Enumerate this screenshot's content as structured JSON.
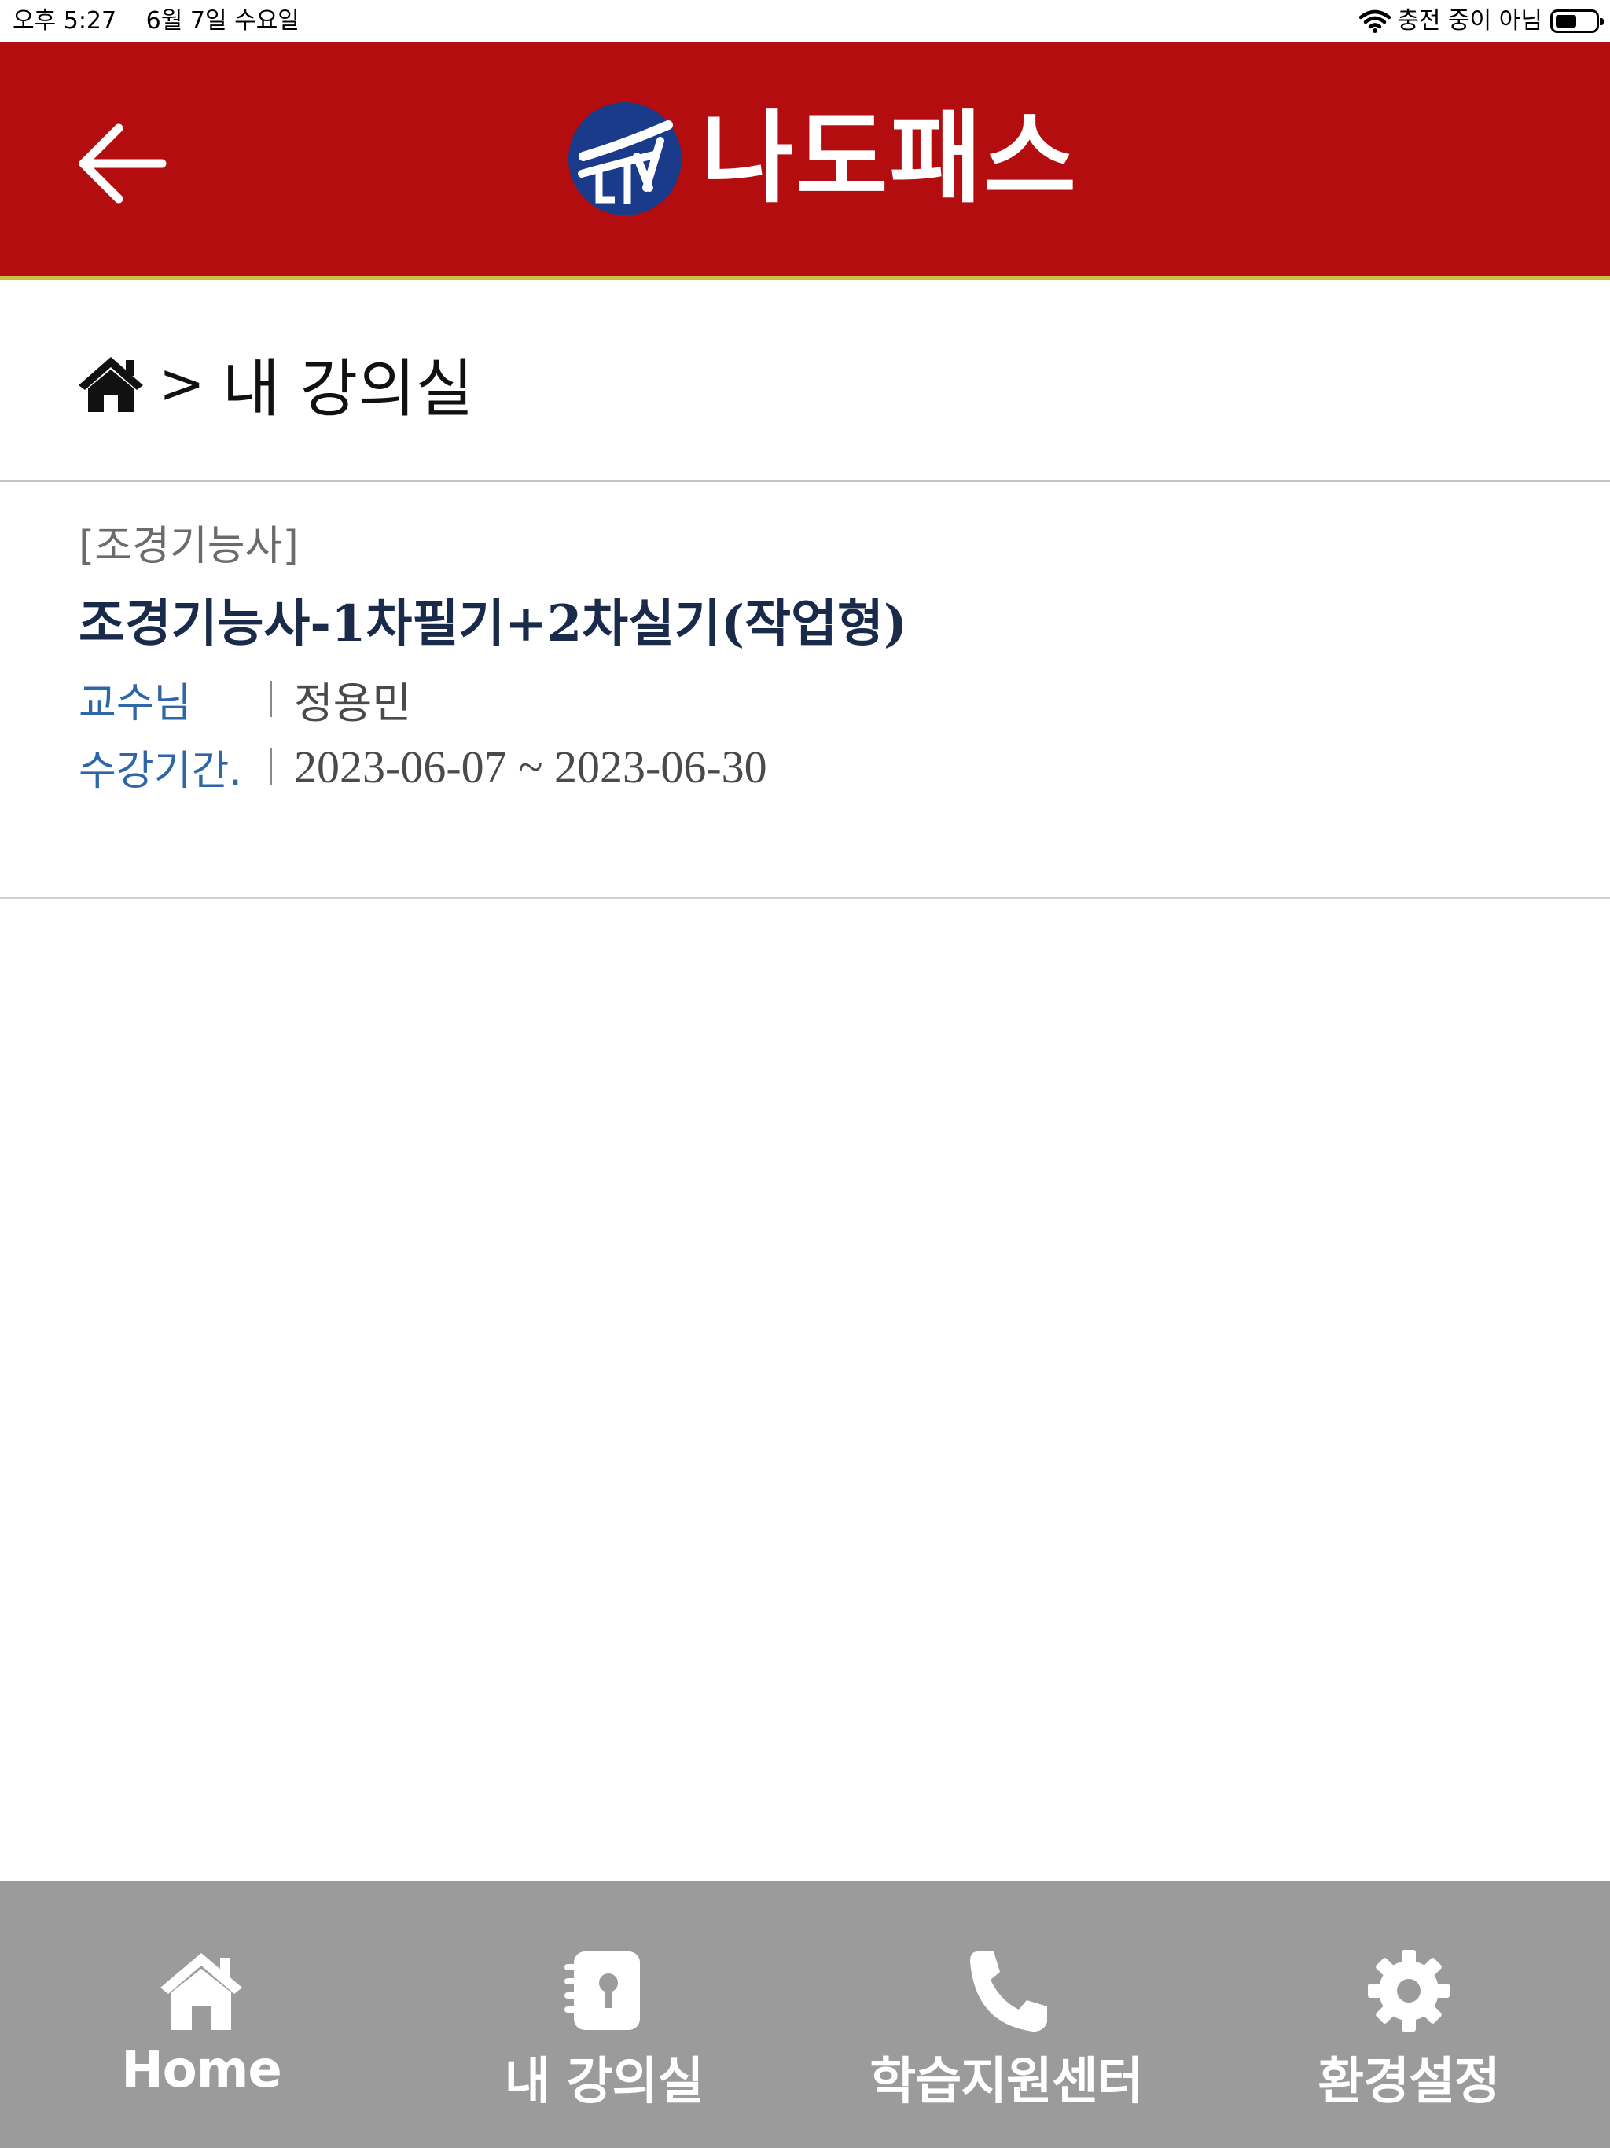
{
  "status_bar": {
    "time": "오후 5:27",
    "date": "6월 7일 수요일",
    "charging": "충전 중이 아님"
  },
  "header": {
    "logo_text": "나도패스",
    "colors": {
      "header_bg": "#b40d10",
      "logo_circle": "#1a3a8a",
      "accent_line": "#c8c23a"
    }
  },
  "breadcrumb": {
    "separator": ">",
    "current": "내 강의실"
  },
  "course": {
    "category": "[조경기능사]",
    "title": "조경기능사-1차필기+2차실기(작업형)",
    "professor_label": "교수님",
    "professor": "정용민",
    "period_label": "수강기간.",
    "period": "2023-06-07 ~ 2023-06-30"
  },
  "bottom_nav": {
    "items": [
      {
        "label": "Home",
        "icon": "home-icon"
      },
      {
        "label": "내 강의실",
        "icon": "notebook-icon"
      },
      {
        "label": "학습지원센터",
        "icon": "phone-icon"
      },
      {
        "label": "환경설정",
        "icon": "gear-icon"
      }
    ]
  }
}
